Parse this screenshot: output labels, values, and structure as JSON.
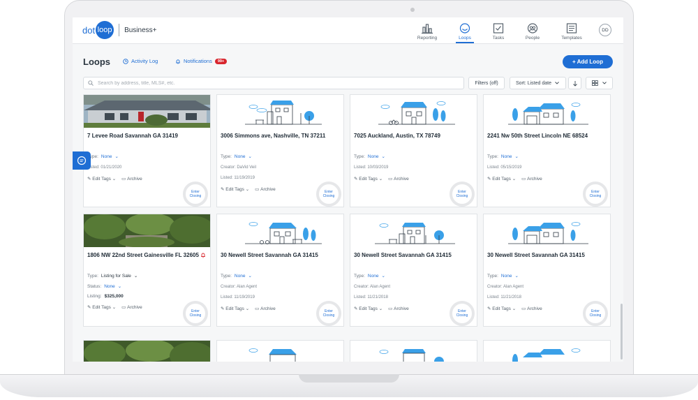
{
  "brand": {
    "dot": "dot",
    "loop": "loop",
    "plan": "Business+"
  },
  "nav": {
    "reporting": "Reporting",
    "loops": "Loops",
    "tasks": "Tasks",
    "people": "People",
    "templates": "Templates",
    "avatar": "DD"
  },
  "page": {
    "title": "Loops",
    "activity_log": "Activity Log",
    "notifications": "Notifications",
    "notifications_count": "99+",
    "add_loop": "+ Add Loop"
  },
  "toolbar": {
    "search_placeholder": "Search by address, title, MLS#, etc.",
    "filters": "Filters (off)",
    "sort": "Sort: Listed date"
  },
  "labels": {
    "type": "Type:",
    "status": "Status:",
    "listing": "Listing:",
    "edit_tags": "Edit Tags",
    "archive": "Archive",
    "enter_closing_1": "Enter",
    "enter_closing_2": "Closing"
  },
  "cards": [
    {
      "address": "7 Levee Road Savannah GA 31419",
      "type": "None",
      "creator": "",
      "listed": "Listed: 01/21/2020"
    },
    {
      "address": "3006 Simmons ave, Nashville, TN 37211",
      "type": "None",
      "creator": "Creator: DaVid Veil",
      "listed": "Listed: 11/19/2019"
    },
    {
      "address": "7025 Auckland, Austin, TX 78749",
      "type": "None",
      "creator": "",
      "listed": "Listed: 10/03/2019"
    },
    {
      "address": "2241 Nw 50th Street Lincoln NE 68524",
      "type": "None",
      "creator": "",
      "listed": "Listed: 05/15/2019"
    },
    {
      "address": "1806 NW 22nd Street Gainesville FL 32605",
      "type": "Listing for Sale",
      "status": "None",
      "listing": "$325,000",
      "creator": "",
      "listed": ""
    },
    {
      "address": "30 Newell Street Savannah GA 31415",
      "type": "None",
      "creator": "Creator: Alan Agent",
      "listed": "Listed: 11/19/2019"
    },
    {
      "address": "30 Newell Street Savannah GA 31415",
      "type": "None",
      "creator": "Creator: Alan Agent",
      "listed": "Listed: 11/21/2018"
    },
    {
      "address": "30 Newell Street Savannah GA 31415",
      "type": "None",
      "creator": "Creator: Alan Agent",
      "listed": "Listed: 11/21/2018"
    }
  ],
  "colors": {
    "accent": "#1f6ed4",
    "badge": "#d8262e"
  }
}
